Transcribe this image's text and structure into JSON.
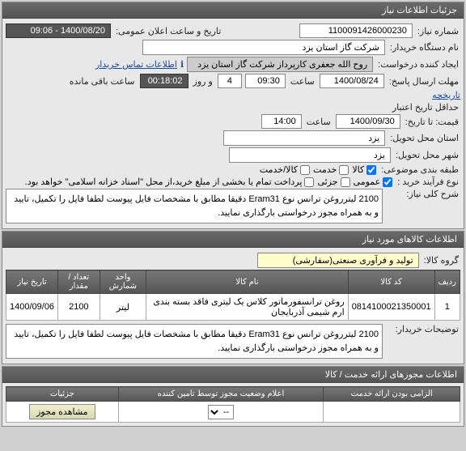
{
  "panels": {
    "main_title": "جزئیات اطلاعات نیاز",
    "req_no_label": "شماره نیاز:",
    "req_no": "1100091426000230",
    "announce_label": "تاریخ و ساعت اعلان عمومی:",
    "announce_value": "1400/08/20 - 09:06",
    "buyer_label": "نام دستگاه خریدار:",
    "buyer_value": "شرکت گاز استان یزد",
    "requester_label": "ایجاد کننده درخواست:",
    "requester_value": "روح الله جعفری کارپرداز شرکت گاز استان یزد",
    "contact_link": "اطلاعات تماس خریدار",
    "deadline_label": "مهلت ارسال پاسخ:",
    "deadline_date": "1400/08/24",
    "deadline_time_label": "ساعت",
    "deadline_time": "09:30",
    "day_label": "و روز",
    "day_value": "4",
    "remaining_label": "ساعت باقی مانده",
    "remaining_value": "00:18:02",
    "history_label": "تاریخچه",
    "min_label": "حداقل تاریخ اعتبار",
    "price_label": "قیمت: تا تاریخ:",
    "price_date": "1400/09/30",
    "price_time_label": "ساعت",
    "price_time": "14:00",
    "state_req_label": "استان محل تحویل:",
    "state_req": "یزد",
    "city_req_label": "شهر محل تحویل:",
    "city_req": "یزد",
    "category_label": "طبقه بندی موضوعی:",
    "cat_goods": "کالا",
    "cat_service": "خدمت",
    "cat_both": "کالا/خدمت",
    "purchase_label": "نوع فرآیند خرید :",
    "purchase_type": "عمومی",
    "pay_part": "جزئی",
    "pay_note": "پرداخت تمام یا بخشی از مبلغ خرید،از محل \"اسناد خزانه اسلامی\" خواهد بود.",
    "desc_label": "شرح کلی نیاز:",
    "desc_text": "2100 لیترروغن ترانس نوع Eram31 دقیقا مطابق با مشخصات فایل پیوست لطفا فایل را تکمیل، تایید و به همراه مجوز درخواستی بارگذاری نمایید.",
    "goods_title": "اطلاعات کالاهای مورد نیاز",
    "group_label": "گروه کالا:",
    "group_value": "تولید و فرآوری صنعتی(سفارشی)",
    "table": {
      "headers": [
        "ردیف",
        "کد کالا",
        "نام کالا",
        "واحد شمارش",
        "تعداد / مقدار",
        "تاریخ نیاز"
      ],
      "rows": [
        {
          "idx": "1",
          "code": "0814100021350001",
          "name": "روغن ترانسفورماتور کلاس یک لیتری فاقد بسته بندی ارم شیمی آذربایجان",
          "unit": "لیتر",
          "qty": "2100",
          "date": "1400/09/06"
        }
      ]
    },
    "buyer_notes_label": "توضیحات خریدار:",
    "buyer_notes": "2100 لیترروغن ترانس نوع Eram31 دقیقا مطابق با مشخصات فایل پیوست لطفا فایل را تکمیل، تایید و به همراه مجوز درخواستی بارگذاری نمایید.",
    "license_title": "اطلاعات مجوزهای ارائه خدمت / کالا",
    "lic_headers": [
      "الزامی بودن ارائه خدمت",
      "اعلام وضعیت مجوز توسط تامین کننده",
      "جزئیات"
    ],
    "lic_select": "--",
    "lic_btn": "مشاهده مجوز"
  }
}
